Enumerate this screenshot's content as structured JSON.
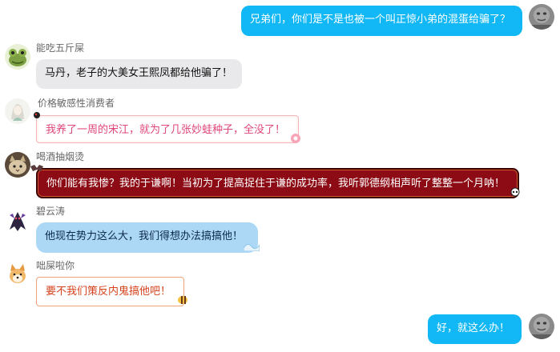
{
  "messages": [
    {
      "sender": "",
      "text": "兄弟们，你们是不是也被一个叫正惊小弟的混蛋给骗了？",
      "self": true
    },
    {
      "sender": "能吃五斤屎",
      "text": "马丹，老子的大美女王熙凤都给他骗了！"
    },
    {
      "sender": "价格敏感性消费者",
      "text": "我养了一周的宋江，就为了几张妙蛙种子，全没了！"
    },
    {
      "sender": "喝酒抽烟烫",
      "text": "你们能有我惨？我的于谦啊！当初为了提高捉住于谦的成功率，我听郭德纲相声听了整整一个月呐！"
    },
    {
      "sender": "碧云涛",
      "text": "他现在势力这么大，我们得想办法搞搞他！"
    },
    {
      "sender": "咄屎啦你",
      "text": "要不我们策反内鬼搞他吧！"
    },
    {
      "sender": "",
      "text": "好，就这么办！",
      "self": true
    }
  ],
  "avatars": {
    "self": "gray-face-avatar",
    "m1": "frog-avatar",
    "m2": "sketch-girl-avatar",
    "m3": "cat-avatar",
    "m4": "dark-character-avatar",
    "m5": "shiba-dog-avatar"
  },
  "colors": {
    "self_bubble": "#12b7f5",
    "gray_bubble": "#e9e9eb",
    "red_bubble": "#8d0b14",
    "blue_bubble": "#acd8f5"
  }
}
